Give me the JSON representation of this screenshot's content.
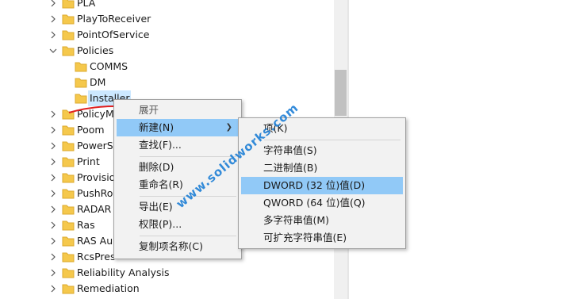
{
  "tree": {
    "items": [
      {
        "label": "PLA",
        "expander": "chevron-right"
      },
      {
        "label": "PlayToReceiver",
        "expander": "chevron-right"
      },
      {
        "label": "PointOfService",
        "expander": "chevron-right"
      },
      {
        "label": "Policies",
        "expander": "chevron-down"
      },
      {
        "label": "COMMS",
        "expander": "none"
      },
      {
        "label": "DM",
        "expander": "none"
      },
      {
        "label": "Installer",
        "expander": "none",
        "selected": true
      },
      {
        "label": "PolicyM",
        "expander": "chevron-right"
      },
      {
        "label": "Poom",
        "expander": "chevron-right"
      },
      {
        "label": "PowerS",
        "expander": "chevron-right"
      },
      {
        "label": "Print",
        "expander": "chevron-right"
      },
      {
        "label": "Provisio",
        "expander": "chevron-right"
      },
      {
        "label": "PushRo",
        "expander": "chevron-right"
      },
      {
        "label": "RADAR",
        "expander": "chevron-right"
      },
      {
        "label": "Ras",
        "expander": "chevron-right"
      },
      {
        "label": "RAS Au",
        "expander": "chevron-right"
      },
      {
        "label": "RcsPres",
        "expander": "chevron-right"
      },
      {
        "label": "Reliability Analysis",
        "expander": "chevron-right"
      },
      {
        "label": "Remediation",
        "expander": "chevron-right"
      }
    ]
  },
  "context_menu": {
    "items": [
      {
        "label": "展开",
        "disabled": true
      },
      {
        "label": "新建(N)",
        "submenu": true,
        "highlighted": true
      },
      {
        "label": "查找(F)..."
      },
      {
        "separator": true
      },
      {
        "label": "删除(D)"
      },
      {
        "label": "重命名(R)"
      },
      {
        "separator": true
      },
      {
        "label": "导出(E)"
      },
      {
        "label": "权限(P)..."
      },
      {
        "separator": true
      },
      {
        "label": "复制项名称(C)"
      }
    ]
  },
  "submenu": {
    "items": [
      {
        "label": "项(K)"
      },
      {
        "separator": true
      },
      {
        "label": "字符串值(S)"
      },
      {
        "label": "二进制值(B)"
      },
      {
        "label": "DWORD (32 位)值(D)",
        "highlighted": true
      },
      {
        "label": "QWORD (64 位)值(Q)"
      },
      {
        "label": "多字符串值(M)"
      },
      {
        "label": "可扩充字符串值(E)"
      }
    ]
  },
  "watermark": {
    "text": "www.solidworks.com"
  },
  "colors": {
    "folder": "#f5c84c",
    "folder_dark": "#dcaa2e",
    "menu_bg": "#f2f2f2",
    "highlight": "#91c9f7",
    "watermark": "#1e7fd6",
    "annotation": "#e02020"
  }
}
